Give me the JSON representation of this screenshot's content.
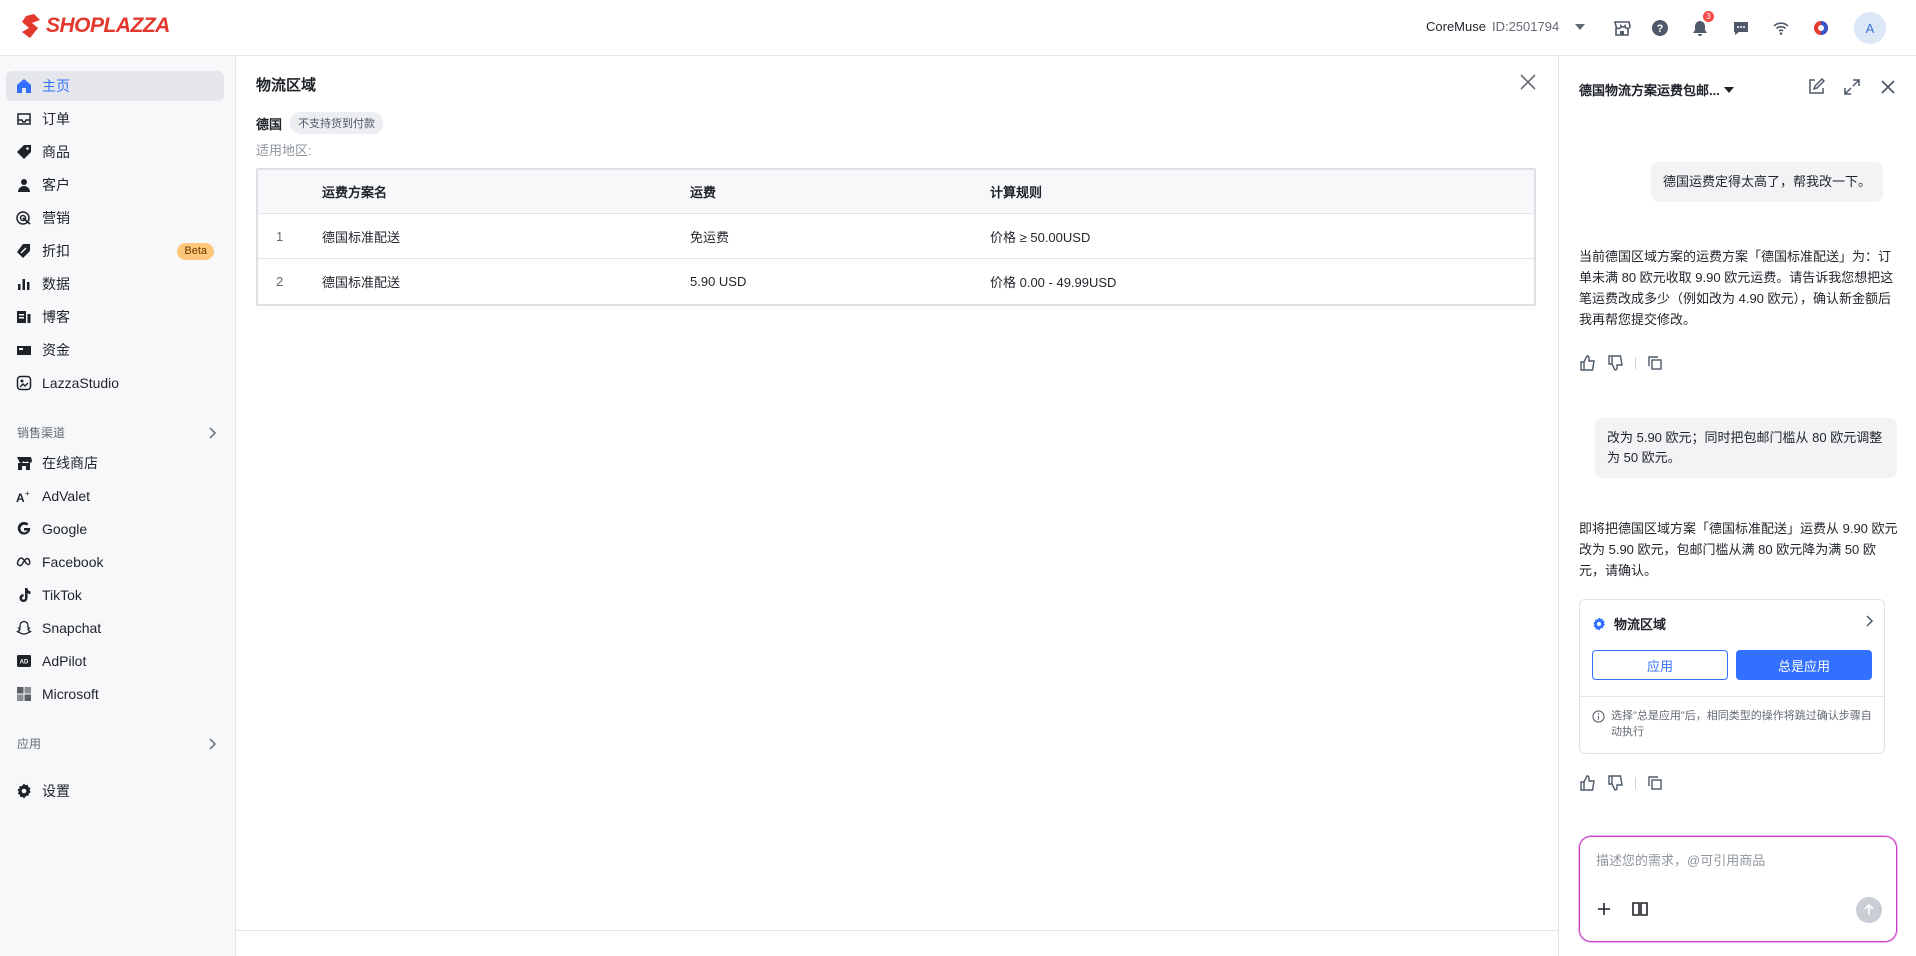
{
  "brand": {
    "name": "SHOPLAZZA",
    "color": "#e2382d"
  },
  "header": {
    "store_name": "CoreMuse",
    "store_id": "ID:2501794",
    "notification_count": "3",
    "avatar_letter": "A"
  },
  "sidebar": {
    "items": [
      {
        "label": "主页",
        "icon": "home-icon"
      },
      {
        "label": "订单",
        "icon": "inbox-icon"
      },
      {
        "label": "商品",
        "icon": "tag-icon"
      },
      {
        "label": "客户",
        "icon": "user-icon"
      },
      {
        "label": "营销",
        "icon": "target-icon"
      },
      {
        "label": "折扣",
        "icon": "discount-icon",
        "badge": "Beta"
      },
      {
        "label": "数据",
        "icon": "bar-chart-icon"
      },
      {
        "label": "博客",
        "icon": "blog-icon"
      },
      {
        "label": "资金",
        "icon": "wallet-icon"
      },
      {
        "label": "LazzaStudio",
        "icon": "studio-icon"
      }
    ],
    "sales_channels_label": "销售渠道",
    "channels": [
      {
        "label": "在线商店",
        "icon": "store-icon"
      },
      {
        "label": "AdValet",
        "icon": "advalet-icon"
      },
      {
        "label": "Google",
        "icon": "google-icon"
      },
      {
        "label": "Facebook",
        "icon": "meta-icon"
      },
      {
        "label": "TikTok",
        "icon": "tiktok-icon"
      },
      {
        "label": "Snapchat",
        "icon": "snapchat-icon"
      },
      {
        "label": "AdPilot",
        "icon": "adpilot-icon"
      },
      {
        "label": "Microsoft",
        "icon": "microsoft-icon"
      }
    ],
    "apps_label": "应用",
    "settings_label": "设置"
  },
  "main": {
    "title": "物流区域",
    "country": "德国",
    "country_tag": "不支持货到付款",
    "region_label": "适用地区:",
    "table": {
      "columns": [
        "运费方案名",
        "运费",
        "计算规则"
      ],
      "rows": [
        {
          "index": "1",
          "name": "德国标准配送",
          "fee": "免运费",
          "rule": "价格 ≥ 50.00USD"
        },
        {
          "index": "2",
          "name": "德国标准配送",
          "fee": "5.90 USD",
          "rule": "价格 0.00 - 49.99USD"
        }
      ]
    }
  },
  "chat": {
    "title": "德国物流方案运费包邮...",
    "messages": [
      {
        "role": "user",
        "text": "德国运费定得太高了，帮我改一下。"
      },
      {
        "role": "assistant",
        "text": "当前德国区域方案的运费方案「德国标准配送」为：订单未满 80 欧元收取 9.90 欧元运费。请告诉我您想把这笔运费改成多少（例如改为 4.90 欧元），确认新金额后我再帮您提交修改。"
      },
      {
        "role": "user",
        "text": "改为 5.90 欧元；同时把包邮门槛从 80 欧元调整为 50 欧元。"
      },
      {
        "role": "assistant",
        "text": "即将把德国区域方案「德国标准配送」运费从 9.90 欧元改为 5.90 欧元，包邮门槛从满 80 欧元降为满 50 欧元，请确认。"
      }
    ],
    "action_card": {
      "title": "物流区域",
      "apply_label": "应用",
      "always_apply_label": "总是应用",
      "note": "选择\"总是应用\"后，相同类型的操作将跳过确认步骤自动执行"
    },
    "input_placeholder": "描述您的需求，@可引用商品"
  },
  "colors": {
    "accent": "#3370ff",
    "input_border": "#c93ac0",
    "beta_badge": "#ffc77a"
  }
}
